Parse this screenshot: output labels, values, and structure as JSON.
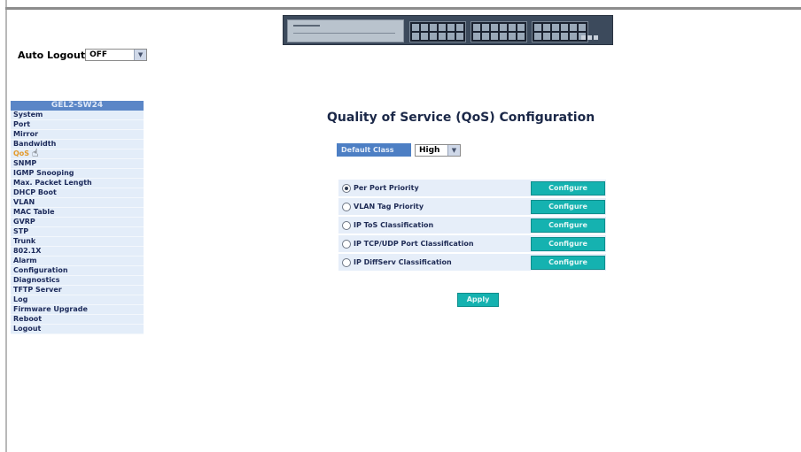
{
  "auto_logout": {
    "label": "Auto Logout",
    "value": "OFF"
  },
  "sidebar": {
    "header": "GEL2-SW24",
    "items": [
      "System",
      "Port",
      "Mirror",
      "Bandwidth",
      "QoS",
      "SNMP",
      "IGMP Snooping",
      "Max. Packet Length",
      "DHCP Boot",
      "VLAN",
      "MAC Table",
      "GVRP",
      "STP",
      "Trunk",
      "802.1X",
      "Alarm",
      "Configuration",
      "Diagnostics",
      "TFTP Server",
      "Log",
      "Firmware Upgrade",
      "Reboot",
      "Logout"
    ]
  },
  "page": {
    "title": "Quality of Service (QoS) Configuration"
  },
  "default_class": {
    "label": "Default Class",
    "value": "High"
  },
  "qos_options": [
    {
      "label": "Per Port Priority",
      "selected": true,
      "button": "Configure"
    },
    {
      "label": "VLAN Tag Priority",
      "selected": false,
      "button": "Configure"
    },
    {
      "label": "IP ToS Classification",
      "selected": false,
      "button": "Configure"
    },
    {
      "label": "IP TCP/UDP Port Classification",
      "selected": false,
      "button": "Configure"
    },
    {
      "label": "IP DiffServ Classification",
      "selected": false,
      "button": "Configure"
    }
  ],
  "apply_label": "Apply",
  "colors": {
    "sidebar_header": "#5b86c7",
    "sidebar_item_bg": "#e3edf9",
    "button_teal": "#15b2b0",
    "row_bg": "#e6eef9"
  }
}
